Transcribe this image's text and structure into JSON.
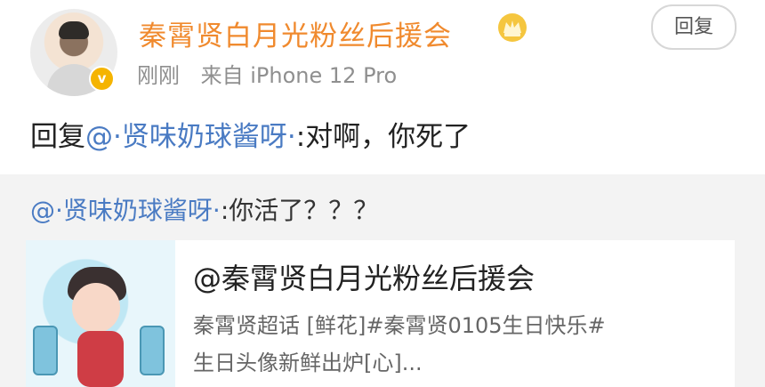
{
  "post": {
    "username": "秦霄贤白月光粉丝后援会",
    "time": "刚刚",
    "source": "来自 iPhone 12 Pro",
    "reply_label": "回复",
    "reply_prefix": "回复",
    "reply_mention": "@·贤味奶球酱呀·",
    "reply_text": ":对啊，你死了",
    "verified_mark": "v",
    "crown_icon": "crown-icon"
  },
  "quote": {
    "mention": "@·贤味奶球酱呀·",
    "text": ":你活了？？？"
  },
  "card": {
    "title": "@秦霄贤白月光粉丝后援会",
    "line1": "秦霄贤超话 [鲜花]#秦霄贤0105生日快乐#",
    "line2": "生日头像新鲜出炉[心]..."
  }
}
